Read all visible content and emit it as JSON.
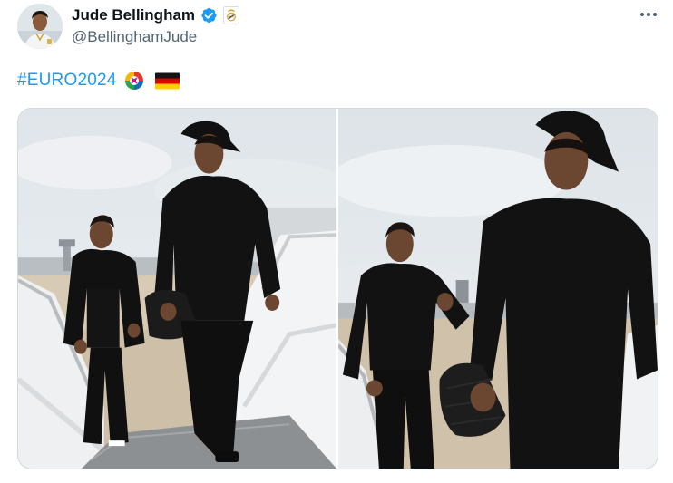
{
  "tweet": {
    "author": {
      "display_name": "Jude Bellingham",
      "handle": "@BellinghamJude",
      "verified_icon": "verified-badge-icon",
      "affiliation_icon": "real-madrid-crest-icon",
      "avatar_alt": "avatar"
    },
    "more_icon": "more-options-icon",
    "text": {
      "hashtag": "#EURO2024",
      "emojis": [
        "euro2024-logo-emoji",
        "germany-flag-emoji"
      ]
    },
    "media": {
      "count": 2,
      "photos": [
        {
          "name": "photo-1"
        },
        {
          "name": "photo-2"
        }
      ]
    },
    "colors": {
      "link": "#1d9bf0",
      "verified": "#1d9bf0",
      "secondary_text": "#536471",
      "primary_text": "#0f1419",
      "border": "#cfd9de"
    }
  }
}
